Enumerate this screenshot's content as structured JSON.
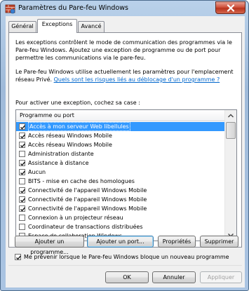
{
  "window": {
    "title": "Paramètres du Pare-feu Windows"
  },
  "tabs": [
    {
      "label": "Général"
    },
    {
      "label": "Exceptions"
    },
    {
      "label": "Avancé"
    }
  ],
  "intro": {
    "paragraph1": "Les exceptions contrôlent le mode de communication des programmes via le Pare-feu Windows. Ajoutez une exception de programme ou de port pour permettre les communications via le pare-feu.",
    "paragraph2": "Le Pare-feu Windows utilise actuellement les paramètres pour l'emplacement réseau Privé.",
    "link": "Quels sont les risques liés au déblocage d'un programme ?",
    "instruction": "Pour activer une exception, cochez sa case :"
  },
  "list": {
    "header": "Programme ou port",
    "items": [
      {
        "label": "Accès à mon serveur Web libellules",
        "checked": true,
        "selected": true
      },
      {
        "label": "Accès réseau Windows Mobile",
        "checked": true,
        "selected": false
      },
      {
        "label": "Accès réseau Windows Mobile",
        "checked": true,
        "selected": false
      },
      {
        "label": "Administration distante",
        "checked": false,
        "selected": false
      },
      {
        "label": "Assistance à distance",
        "checked": true,
        "selected": false
      },
      {
        "label": "Aucun",
        "checked": true,
        "selected": false
      },
      {
        "label": "BITS - mise en cache des homologues",
        "checked": false,
        "selected": false
      },
      {
        "label": "Connectivité de l'appareil Windows Mobile",
        "checked": true,
        "selected": false
      },
      {
        "label": "Connectivité de l'appareil Windows Mobile",
        "checked": true,
        "selected": false
      },
      {
        "label": "Connectivité de l'appareil Windows Mobile",
        "checked": true,
        "selected": false
      },
      {
        "label": "Connexion à un projecteur réseau",
        "checked": false,
        "selected": false
      },
      {
        "label": "Coordinateur de transactions distribuées",
        "checked": false,
        "selected": false
      },
      {
        "label": "Espace de collaboration Windows",
        "checked": false,
        "selected": false
      }
    ]
  },
  "actions": {
    "add_program": "Ajouter un programme...",
    "add_port": "Ajouter un port...",
    "properties": "Propriétés",
    "remove": "Supprimer"
  },
  "notify": {
    "label": "Me prévenir lorsque le Pare-feu Windows bloque un nouveau programme",
    "checked": true
  },
  "dialog_buttons": {
    "ok": "OK",
    "cancel": "Annuler",
    "apply": "Appliquer"
  },
  "colors": {
    "selection": "#3399ff",
    "link": "#0066cc"
  }
}
